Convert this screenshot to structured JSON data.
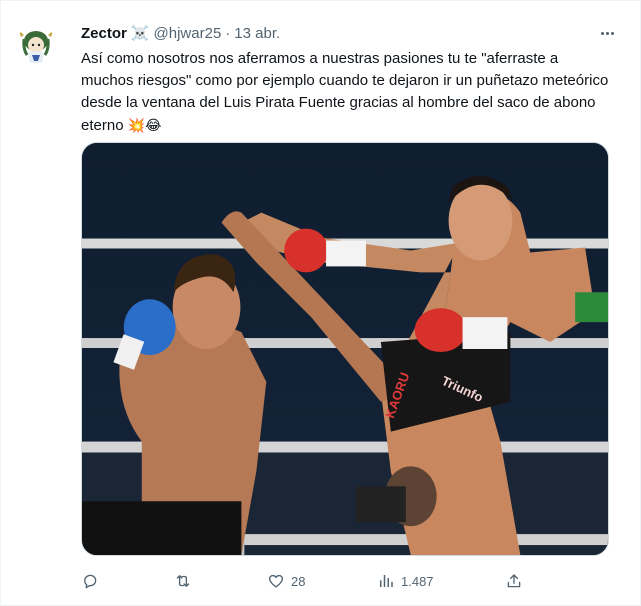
{
  "author": {
    "display_name": "Zector",
    "name_emoji": "☠️",
    "handle": "@hjwar25",
    "separator": "·",
    "date": "13 abr."
  },
  "tweet": {
    "text": "Así como nosotros nos aferramos a nuestras pasiones tu te \"aferraste a muchos riesgos\" como por ejemplo cuando te dejaron ir un puñetazo meteórico desde la ventana del Luis Pirata Fuente gracias al hombre del saco de abono eterno",
    "emojis": "💥😂"
  },
  "media": {
    "shorts_left_text": "",
    "shorts_right_text_1": "KAORU",
    "shorts_right_text_2": "Triunfo"
  },
  "actions": {
    "reply": {
      "icon": "reply-icon",
      "count": ""
    },
    "retweet": {
      "icon": "retweet-icon",
      "count": ""
    },
    "like": {
      "icon": "heart-icon",
      "count": "28"
    },
    "views": {
      "icon": "views-icon",
      "count": "1.487"
    },
    "share": {
      "icon": "share-icon"
    }
  },
  "colors": {
    "text": "#0f1419",
    "secondary": "#536471",
    "border": "#cfd9de"
  }
}
